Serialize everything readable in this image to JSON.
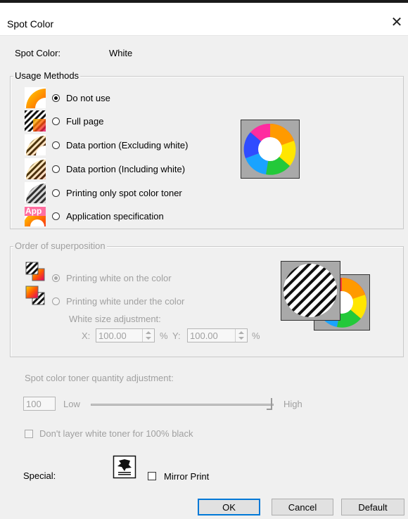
{
  "window": {
    "title": "Spot Color",
    "close_glyph": "✕"
  },
  "spot_color": {
    "label": "Spot Color:",
    "value": "White"
  },
  "usage_methods": {
    "legend": "Usage Methods",
    "selected": "Do not use",
    "options": [
      {
        "label": "Do not use",
        "icon": "rainbow-swirl-icon",
        "selected": true
      },
      {
        "label": "Full page",
        "icon": "full-page-hatch-icon",
        "selected": false
      },
      {
        "label": "Data portion (Excluding white)",
        "icon": "data-excluding-white-icon",
        "selected": false
      },
      {
        "label": "Data portion (Including white)",
        "icon": "data-including-white-icon",
        "selected": false
      },
      {
        "label": "Printing only spot color toner",
        "icon": "spot-toner-only-icon",
        "selected": false
      },
      {
        "label": "Application specification",
        "icon": "application-spec-icon",
        "icon_text": "App",
        "selected": false
      }
    ],
    "preview_icon": "color-ring-preview-icon"
  },
  "superposition": {
    "legend": "Order of superposition",
    "disabled": true,
    "options": [
      {
        "label": "Printing white on the color",
        "icon": "white-on-color-icon",
        "selected": true
      },
      {
        "label": "Printing white under the color",
        "icon": "white-under-color-icon",
        "selected": false
      }
    ],
    "white_size_label": "White size adjustment:",
    "x_label": "X:",
    "x_value": "100.00",
    "x_unit": "%",
    "y_label": "Y:",
    "y_value": "100.00",
    "y_unit": "%",
    "preview_icon": "superposition-preview-icon"
  },
  "toner": {
    "label": "Spot color toner quantity adjustment:",
    "value": "100",
    "low_label": "Low",
    "high_label": "High",
    "slider_position": 1.0,
    "disabled": true
  },
  "layer_white": {
    "label": "Don't layer white toner for 100% black",
    "checked": false,
    "disabled": true
  },
  "special": {
    "label": "Special:",
    "icon": "mirror-print-icon",
    "mirror_label": "Mirror Print",
    "mirror_checked": false
  },
  "buttons": {
    "ok": "OK",
    "cancel": "Cancel",
    "default": "Default"
  },
  "colors": {
    "dialog_bg": "#f0f0f0",
    "disabled_text": "#a0a0a0",
    "focus_border": "#0078d7",
    "preview_gray": "#a9a9a9"
  }
}
